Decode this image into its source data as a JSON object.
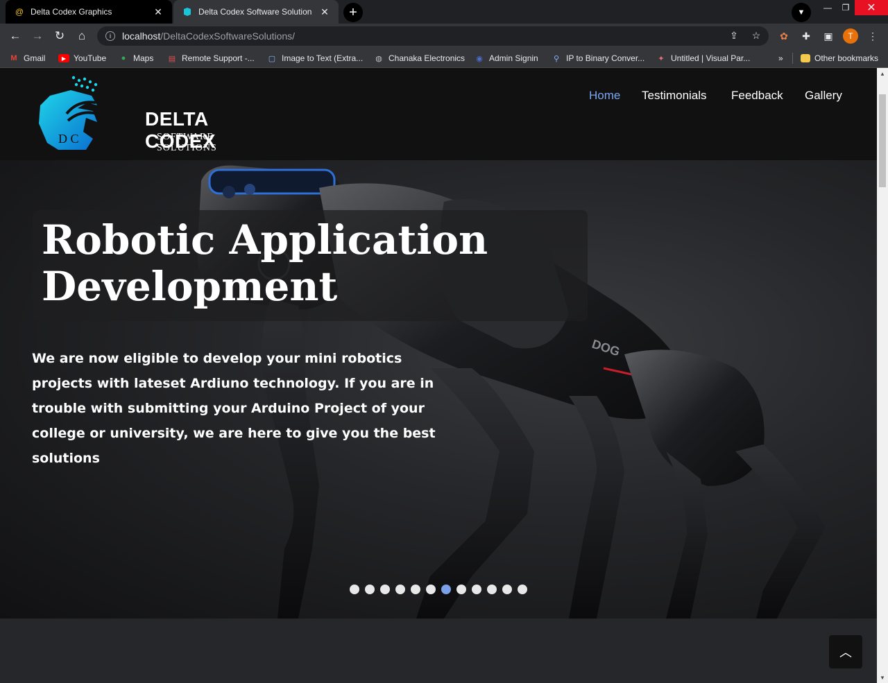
{
  "browser": {
    "tabs": [
      {
        "title": "Delta Codex Graphics",
        "active": false
      },
      {
        "title": "Delta Codex Software Solution",
        "active": true
      }
    ],
    "url_host": "localhost",
    "url_path": "/DeltaCodexSoftwareSolutions/",
    "profile_initial": "T",
    "bookmarks": [
      {
        "label": "Gmail",
        "icon": "gmail-icon"
      },
      {
        "label": "YouTube",
        "icon": "youtube-icon"
      },
      {
        "label": "Maps",
        "icon": "maps-icon"
      },
      {
        "label": "Remote Support -...",
        "icon": "remote-support-icon"
      },
      {
        "label": "Image to Text (Extra...",
        "icon": "image-to-text-icon"
      },
      {
        "label": "Chanaka Electronics",
        "icon": "globe-icon"
      },
      {
        "label": "Admin Signin",
        "icon": "admin-icon"
      },
      {
        "label": "IP to Binary Conver...",
        "icon": "network-icon"
      },
      {
        "label": "Untitled | Visual Par...",
        "icon": "visual-paradigm-icon"
      }
    ],
    "other_bookmarks": "Other bookmarks"
  },
  "site": {
    "brand_name": "DELTA CODEX",
    "brand_sub": "SOFTWARE SOLUTIONS",
    "nav": [
      "Home",
      "Testimonials",
      "Feedback",
      "Gallery"
    ],
    "active_nav": "Home"
  },
  "hero": {
    "title": "Robotic Application Development",
    "text": "We are now eligible to develop your mini robotics projects with lateset Ardiuno technology. If you are in trouble with submitting your Arduino Project of your college or university, we are here to give you the best solutions",
    "slide_count": 12,
    "active_slide": 7
  },
  "colors": {
    "nav_active": "#7aa7f0",
    "header_bg": "#111112",
    "accent_cyan": "#18c6d8"
  }
}
